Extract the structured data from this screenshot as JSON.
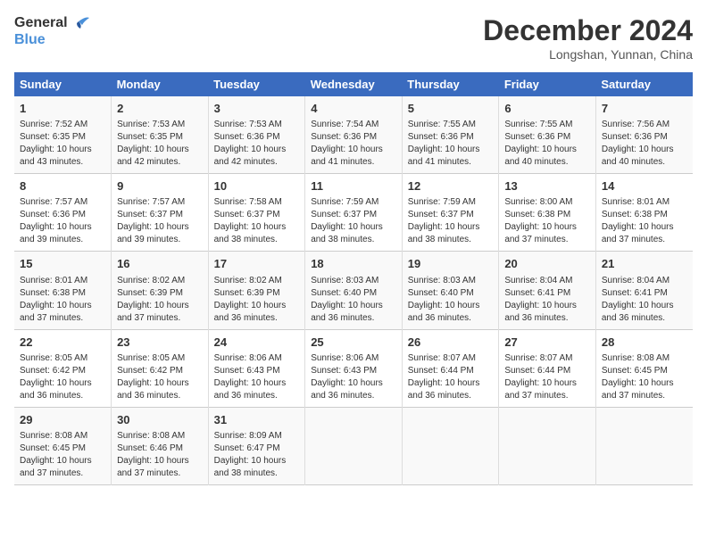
{
  "logo": {
    "line1": "General",
    "line2": "Blue"
  },
  "title": "December 2024",
  "location": "Longshan, Yunnan, China",
  "days_of_week": [
    "Sunday",
    "Monday",
    "Tuesday",
    "Wednesday",
    "Thursday",
    "Friday",
    "Saturday"
  ],
  "weeks": [
    [
      {
        "day": "1",
        "sunrise": "7:52 AM",
        "sunset": "6:35 PM",
        "daylight": "10 hours and 43 minutes."
      },
      {
        "day": "2",
        "sunrise": "7:53 AM",
        "sunset": "6:35 PM",
        "daylight": "10 hours and 42 minutes."
      },
      {
        "day": "3",
        "sunrise": "7:53 AM",
        "sunset": "6:36 PM",
        "daylight": "10 hours and 42 minutes."
      },
      {
        "day": "4",
        "sunrise": "7:54 AM",
        "sunset": "6:36 PM",
        "daylight": "10 hours and 41 minutes."
      },
      {
        "day": "5",
        "sunrise": "7:55 AM",
        "sunset": "6:36 PM",
        "daylight": "10 hours and 41 minutes."
      },
      {
        "day": "6",
        "sunrise": "7:55 AM",
        "sunset": "6:36 PM",
        "daylight": "10 hours and 40 minutes."
      },
      {
        "day": "7",
        "sunrise": "7:56 AM",
        "sunset": "6:36 PM",
        "daylight": "10 hours and 40 minutes."
      }
    ],
    [
      {
        "day": "8",
        "sunrise": "7:57 AM",
        "sunset": "6:36 PM",
        "daylight": "10 hours and 39 minutes."
      },
      {
        "day": "9",
        "sunrise": "7:57 AM",
        "sunset": "6:37 PM",
        "daylight": "10 hours and 39 minutes."
      },
      {
        "day": "10",
        "sunrise": "7:58 AM",
        "sunset": "6:37 PM",
        "daylight": "10 hours and 38 minutes."
      },
      {
        "day": "11",
        "sunrise": "7:59 AM",
        "sunset": "6:37 PM",
        "daylight": "10 hours and 38 minutes."
      },
      {
        "day": "12",
        "sunrise": "7:59 AM",
        "sunset": "6:37 PM",
        "daylight": "10 hours and 38 minutes."
      },
      {
        "day": "13",
        "sunrise": "8:00 AM",
        "sunset": "6:38 PM",
        "daylight": "10 hours and 37 minutes."
      },
      {
        "day": "14",
        "sunrise": "8:01 AM",
        "sunset": "6:38 PM",
        "daylight": "10 hours and 37 minutes."
      }
    ],
    [
      {
        "day": "15",
        "sunrise": "8:01 AM",
        "sunset": "6:38 PM",
        "daylight": "10 hours and 37 minutes."
      },
      {
        "day": "16",
        "sunrise": "8:02 AM",
        "sunset": "6:39 PM",
        "daylight": "10 hours and 37 minutes."
      },
      {
        "day": "17",
        "sunrise": "8:02 AM",
        "sunset": "6:39 PM",
        "daylight": "10 hours and 36 minutes."
      },
      {
        "day": "18",
        "sunrise": "8:03 AM",
        "sunset": "6:40 PM",
        "daylight": "10 hours and 36 minutes."
      },
      {
        "day": "19",
        "sunrise": "8:03 AM",
        "sunset": "6:40 PM",
        "daylight": "10 hours and 36 minutes."
      },
      {
        "day": "20",
        "sunrise": "8:04 AM",
        "sunset": "6:41 PM",
        "daylight": "10 hours and 36 minutes."
      },
      {
        "day": "21",
        "sunrise": "8:04 AM",
        "sunset": "6:41 PM",
        "daylight": "10 hours and 36 minutes."
      }
    ],
    [
      {
        "day": "22",
        "sunrise": "8:05 AM",
        "sunset": "6:42 PM",
        "daylight": "10 hours and 36 minutes."
      },
      {
        "day": "23",
        "sunrise": "8:05 AM",
        "sunset": "6:42 PM",
        "daylight": "10 hours and 36 minutes."
      },
      {
        "day": "24",
        "sunrise": "8:06 AM",
        "sunset": "6:43 PM",
        "daylight": "10 hours and 36 minutes."
      },
      {
        "day": "25",
        "sunrise": "8:06 AM",
        "sunset": "6:43 PM",
        "daylight": "10 hours and 36 minutes."
      },
      {
        "day": "26",
        "sunrise": "8:07 AM",
        "sunset": "6:44 PM",
        "daylight": "10 hours and 36 minutes."
      },
      {
        "day": "27",
        "sunrise": "8:07 AM",
        "sunset": "6:44 PM",
        "daylight": "10 hours and 37 minutes."
      },
      {
        "day": "28",
        "sunrise": "8:08 AM",
        "sunset": "6:45 PM",
        "daylight": "10 hours and 37 minutes."
      }
    ],
    [
      {
        "day": "29",
        "sunrise": "8:08 AM",
        "sunset": "6:45 PM",
        "daylight": "10 hours and 37 minutes."
      },
      {
        "day": "30",
        "sunrise": "8:08 AM",
        "sunset": "6:46 PM",
        "daylight": "10 hours and 37 minutes."
      },
      {
        "day": "31",
        "sunrise": "8:09 AM",
        "sunset": "6:47 PM",
        "daylight": "10 hours and 38 minutes."
      },
      null,
      null,
      null,
      null
    ]
  ],
  "labels": {
    "sunrise": "Sunrise:",
    "sunset": "Sunset:",
    "daylight": "Daylight:"
  }
}
